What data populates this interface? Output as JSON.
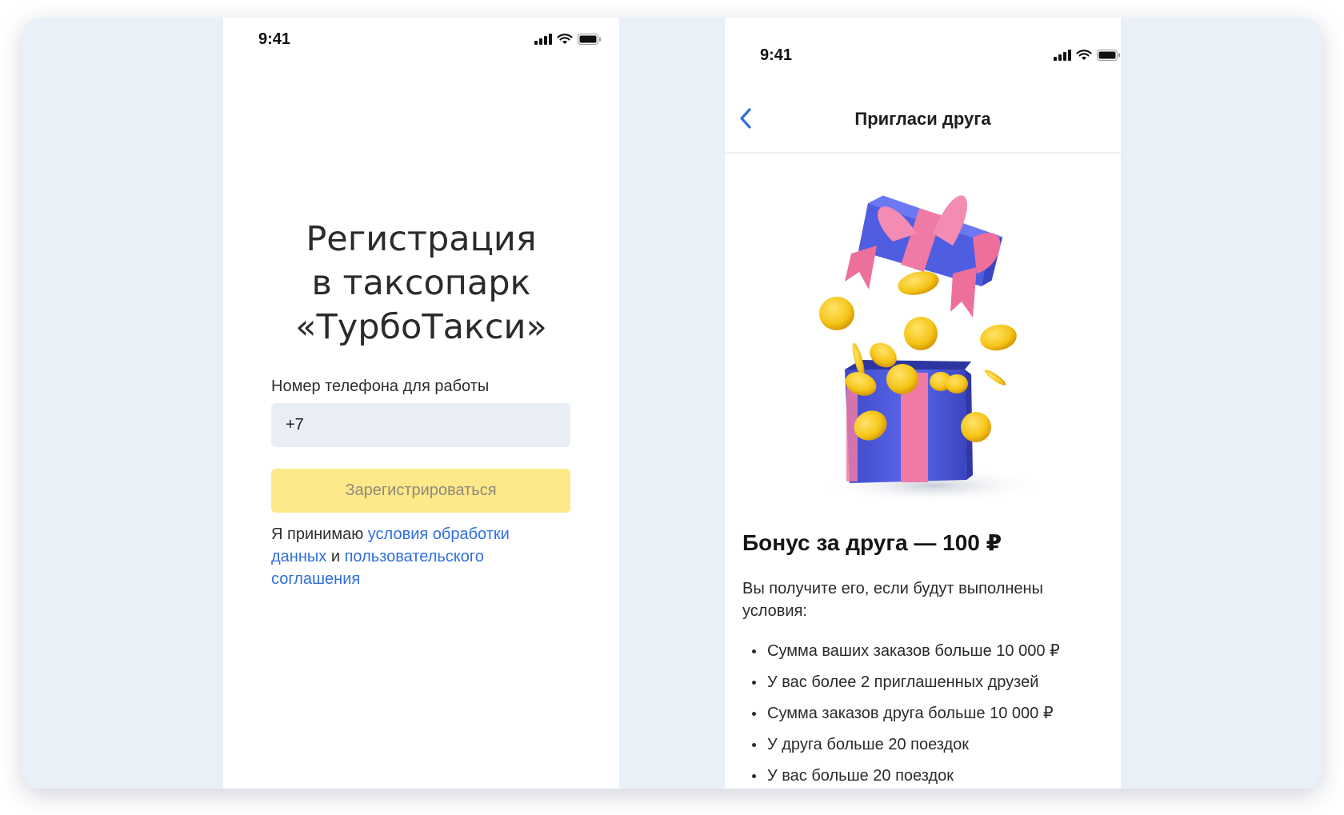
{
  "status_bar": {
    "time": "9:41"
  },
  "registration": {
    "title_lines": [
      "Регистрация",
      "в таксопарк",
      "«ТурбоТакси»"
    ],
    "phone_label": "Номер телефона для работы",
    "phone_value": "+7",
    "register_button": "Зарегистрироваться",
    "terms_prefix": "Я принимаю ",
    "terms_link_1": "условия обработки данных",
    "terms_middle": " и ",
    "terms_link_2": "пользовательского соглашения"
  },
  "invite": {
    "nav_title": "Пригласи друга",
    "bonus_title": "Бонус за друга — 100 ₽",
    "description": "Вы получите его, если будут выполнены условия:",
    "conditions": [
      "Сумма ваших заказов больше 10 000 ₽",
      "У вас более 2 приглашенных друзей",
      "Сумма заказов друга больше 10 000 ₽",
      "У друга больше 20 поездок",
      "У вас больше 20 поездок"
    ]
  },
  "colors": {
    "background": "#eaf0f8",
    "input_bg": "#e9eef5",
    "button_disabled": "#fde88a",
    "link": "#2f6fde",
    "gift_box": "#4f5de0",
    "gift_ribbon": "#ef7aa6",
    "coin": "#f5c518"
  },
  "icons": [
    "signal-icon",
    "wifi-icon",
    "battery-icon",
    "back-chevron-icon",
    "gift-box-illustration"
  ]
}
